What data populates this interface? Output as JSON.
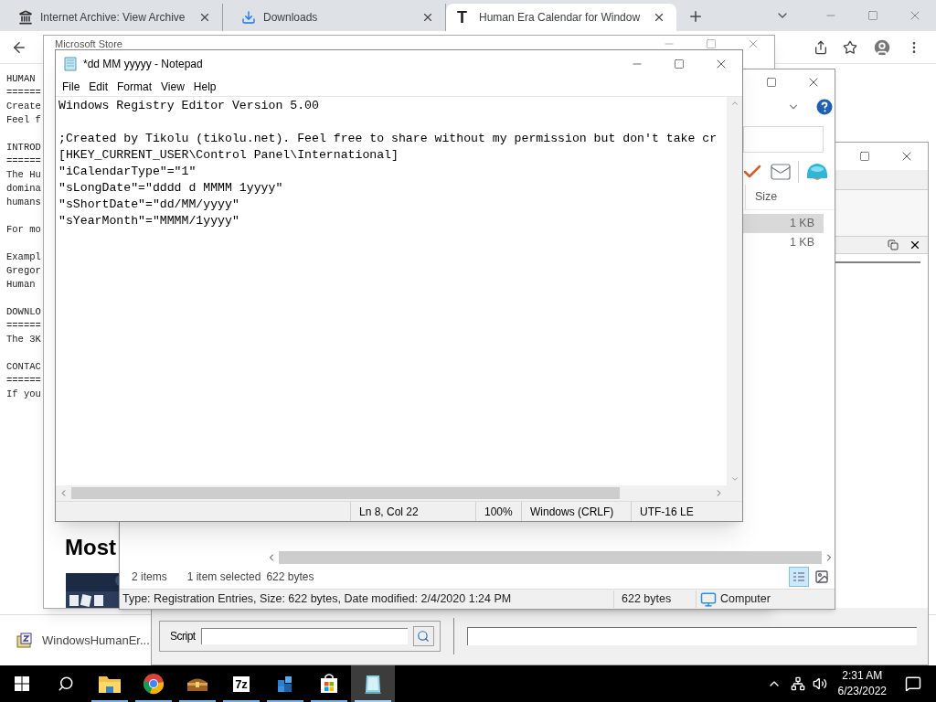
{
  "browser": {
    "tabs": [
      {
        "title": "Internet Archive: View Archive",
        "selected": false
      },
      {
        "title": "Downloads",
        "selected": false
      },
      {
        "title": "Human Era Calendar for Window",
        "favicon": "T",
        "selected": true
      }
    ],
    "page_paragraphs": [
      [
        "HUMAN",
        "======",
        "Create",
        "Feel f"
      ],
      [
        "INTROD",
        "======",
        "The Hu",
        "domina",
        "humans"
      ],
      [
        "For mo"
      ],
      [
        "Exampl",
        "Gregor",
        "Human"
      ],
      [
        "DOWNLO",
        "======",
        "The 3K"
      ],
      [
        "CONTAC",
        "======",
        "If you"
      ]
    ],
    "download": {
      "file": "WindowsHumanEr..."
    }
  },
  "store_window": {
    "title": "Microsoft Store",
    "heading": "Most"
  },
  "explorer_window": {
    "size_column": "Size",
    "rows": [
      {
        "size": "1 KB",
        "selected": true
      },
      {
        "size": "1 KB",
        "selected": false
      }
    ],
    "status": {
      "items": "2 items",
      "selection": "1 item selected",
      "selection_size": "622 bytes"
    },
    "details_bar": {
      "info": "Type: Registration Entries, Size: 622 bytes, Date modified: 2/4/2020 1:24 PM",
      "size": "622 bytes",
      "location": "Computer"
    }
  },
  "script_window": {
    "script_label": "Script"
  },
  "notepad": {
    "title": "*dd MM yyyyy - Notepad",
    "menu": [
      "File",
      "Edit",
      "Format",
      "View",
      "Help"
    ],
    "paragraphs": [
      [
        "Windows Registry Editor Version 5.00"
      ],
      [
        ";Created by Tikolu (tikolu.net). Feel free to share without my permission but don't take cr",
        "[HKEY_CURRENT_USER\\Control Panel\\International]",
        "\"iCalendarType\"=\"1\"",
        "\"sLongDate\"=\"dddd d MMMM 1yyyy\"",
        "\"sShortDate\"=\"dd/MM/yyyy\"",
        "\"sYearMonth\"=\"MMMM/1yyyy\""
      ]
    ],
    "status": [
      "Ln 8, Col 22",
      "100%",
      "Windows (CRLF)",
      "UTF-16 LE"
    ]
  },
  "taskbar": {
    "apps": [
      {
        "kind": "folder",
        "running": true,
        "selected": false
      },
      {
        "kind": "chrome",
        "running": true,
        "selected": false
      },
      {
        "kind": "archive",
        "running": true,
        "selected": false
      },
      {
        "kind": "sevenzip",
        "label": "7z",
        "running": true,
        "selected": false
      },
      {
        "kind": "cube",
        "running": true,
        "selected": false
      },
      {
        "kind": "store",
        "running": true,
        "selected": false
      },
      {
        "kind": "notepad",
        "running": true,
        "selected": true
      }
    ],
    "time": "2:31 AM",
    "date": "6/23/2022"
  }
}
